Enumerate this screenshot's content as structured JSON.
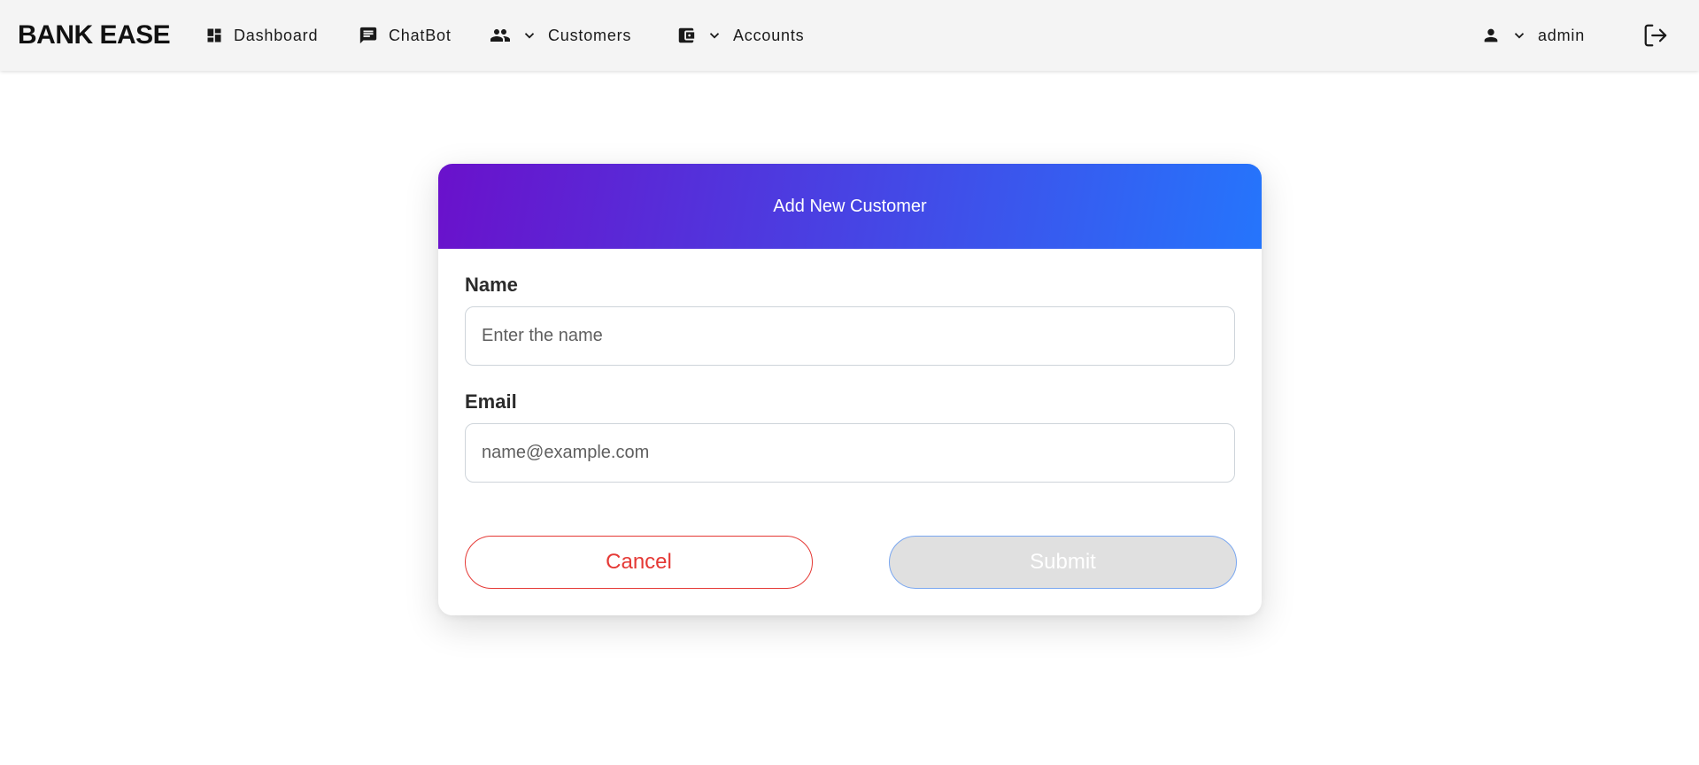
{
  "app": {
    "brand": "BANK EASE"
  },
  "nav": {
    "dashboard": {
      "label": "Dashboard",
      "icon": "dashboard-icon"
    },
    "chatbot": {
      "label": "ChatBot",
      "icon": "chat-icon"
    },
    "customers": {
      "label": "Customers",
      "icon": "people-icon"
    },
    "accounts": {
      "label": "Accounts",
      "icon": "wallet-icon"
    },
    "user": {
      "label": "admin",
      "icon": "person-icon"
    },
    "logout": {
      "icon": "logout-icon"
    }
  },
  "form": {
    "title": "Add New Customer",
    "name": {
      "label": "Name",
      "placeholder": "Enter the name",
      "value": ""
    },
    "email": {
      "label": "Email",
      "placeholder": "name@example.com",
      "value": ""
    },
    "cancel_label": "Cancel",
    "submit_label": "Submit"
  },
  "colors": {
    "header_gradient_start": "#6a11cb",
    "header_gradient_end": "#2575fc",
    "cancel": "#e53935",
    "submit_disabled_bg": "#e0e0e0"
  }
}
